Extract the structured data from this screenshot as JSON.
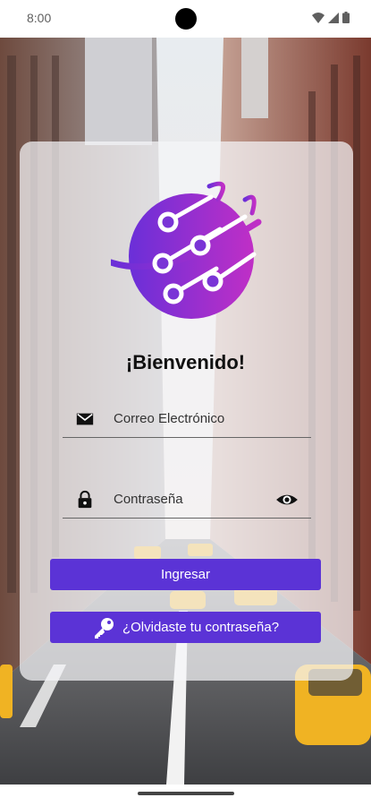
{
  "status_bar": {
    "time": "8:00"
  },
  "card": {
    "welcome": "¡Bienvenido!",
    "email": {
      "placeholder": "Correo Electrónico",
      "icon": "mail-icon"
    },
    "password": {
      "placeholder": "Contraseña",
      "icon": "lock-icon",
      "toggle_icon": "eye-icon"
    },
    "login_label": "Ingresar",
    "forgot_label": "¿Olvidaste tu contraseña?",
    "forgot_icon": "key-icon"
  },
  "colors": {
    "accent": "#5b33d6",
    "logo_from": "#6a2fd8",
    "logo_to": "#c02fc6"
  }
}
